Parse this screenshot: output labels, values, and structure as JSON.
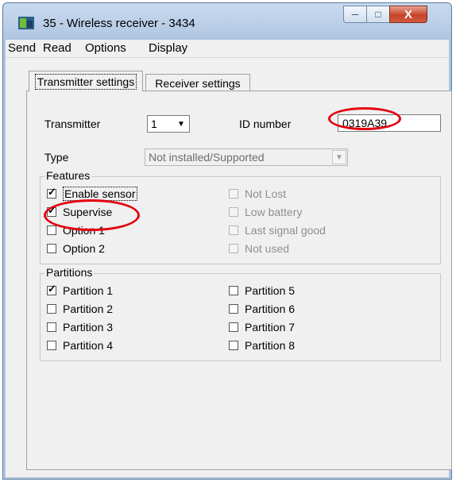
{
  "window": {
    "title": "35 - Wireless receiver - 3434",
    "close_glyph": "X"
  },
  "menu": [
    "Send",
    "Read",
    "Options",
    "Display"
  ],
  "tabs": {
    "active": "Transmitter settings",
    "inactive": "Receiver settings"
  },
  "form": {
    "transmitter_label": "Transmitter",
    "transmitter_value": "1",
    "id_label": "ID number",
    "id_value": "0319A39",
    "type_label": "Type",
    "type_value": "Not installed/Supported"
  },
  "features": {
    "title": "Features",
    "left": [
      {
        "label": "Enable sensor",
        "checked": true
      },
      {
        "label": "Supervise",
        "checked": true
      },
      {
        "label": "Option 1",
        "checked": false
      },
      {
        "label": "Option 2",
        "checked": false
      }
    ],
    "right": [
      {
        "label": "Not Lost",
        "checked": false,
        "disabled": true
      },
      {
        "label": "Low battery",
        "checked": false,
        "disabled": true
      },
      {
        "label": "Last signal good",
        "checked": false,
        "disabled": true
      },
      {
        "label": "Not used",
        "checked": false,
        "disabled": true
      }
    ]
  },
  "partitions": {
    "title": "Partitions",
    "left": [
      {
        "label": "Partition 1",
        "checked": true
      },
      {
        "label": "Partition 2",
        "checked": false
      },
      {
        "label": "Partition 3",
        "checked": false
      },
      {
        "label": "Partition 4",
        "checked": false
      }
    ],
    "right": [
      {
        "label": "Partition 5",
        "checked": false
      },
      {
        "label": "Partition 6",
        "checked": false
      },
      {
        "label": "Partition 7",
        "checked": false
      },
      {
        "label": "Partition 8",
        "checked": false
      }
    ]
  },
  "check_glyph": "✓",
  "dropdown_arrow": "▼",
  "annotation_color": "#e3000f"
}
